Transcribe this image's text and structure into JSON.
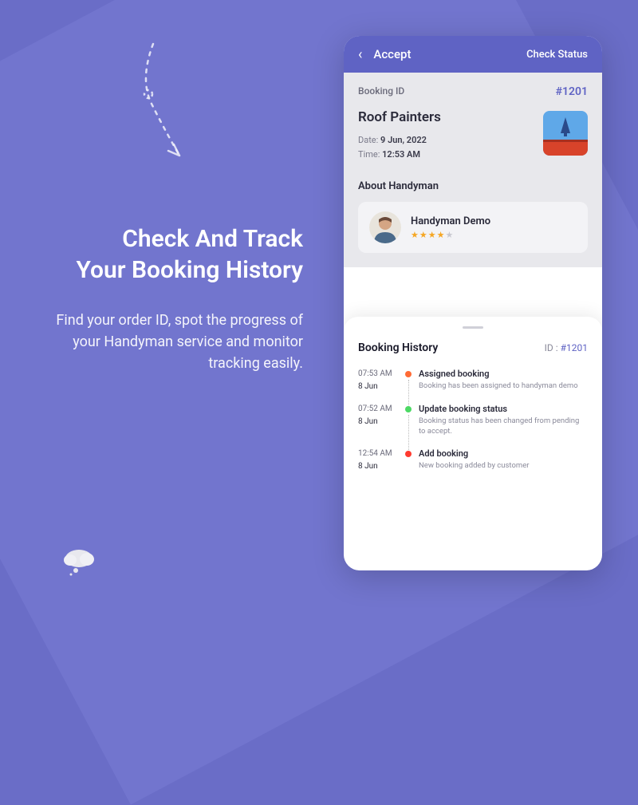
{
  "hero": {
    "heading_line1": "Check And Track",
    "heading_line2": "Your Booking History",
    "subtext": "Find your order ID, spot the progress of your Handyman service and monitor tracking easily."
  },
  "phone": {
    "header": {
      "title": "Accept",
      "action": "Check Status"
    },
    "booking": {
      "id_label": "Booking ID",
      "id_value": "#1201",
      "service_title": "Roof Painters",
      "date_label": "Date:",
      "date_value": "9 Jun, 2022",
      "time_label": "Time:",
      "time_value": "12:53 AM"
    },
    "about": {
      "heading": "About Handyman",
      "name": "Handyman Demo",
      "rating": 4.5
    },
    "sheet": {
      "title": "Booking History",
      "id_label": "ID :",
      "id_value": "#1201",
      "timeline": [
        {
          "time": "07:53 AM",
          "date": "8 Jun",
          "color": "#ff6b35",
          "title": "Assigned booking",
          "desc": "Booking has been assigned to handyman demo"
        },
        {
          "time": "07:52 AM",
          "date": "8 Jun",
          "color": "#4cd964",
          "title": "Update booking status",
          "desc": "Booking status has been changed from pending to accept."
        },
        {
          "time": "12:54 AM",
          "date": "8 Jun",
          "color": "#ff3b30",
          "title": "Add booking",
          "desc": "New booking added by customer"
        }
      ]
    }
  }
}
